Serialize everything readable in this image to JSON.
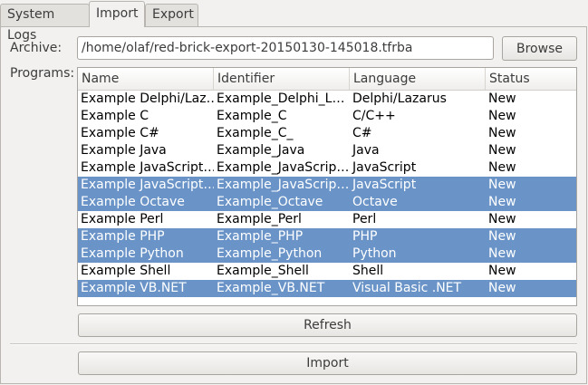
{
  "tabs": [
    {
      "label": "System Logs"
    },
    {
      "label": "Import"
    },
    {
      "label": "Export"
    }
  ],
  "archive": {
    "label": "Archive:",
    "value": "/home/olaf/red-brick-export-20150130-145018.tfrba",
    "browse_label": "Browse"
  },
  "programs": {
    "label": "Programs:",
    "columns": [
      "Name",
      "Identifier",
      "Language",
      "Status"
    ],
    "rows": [
      {
        "name": "Example Delphi/Laz…",
        "id": "Example_Delphi_L…",
        "lang": "Delphi/Lazarus",
        "status": "New",
        "selected": false
      },
      {
        "name": "Example C",
        "id": "Example_C",
        "lang": "C/C++",
        "status": "New",
        "selected": false
      },
      {
        "name": "Example C#",
        "id": "Example_C_",
        "lang": "C#",
        "status": "New",
        "selected": false
      },
      {
        "name": "Example Java",
        "id": "Example_Java",
        "lang": "Java",
        "status": "New",
        "selected": false
      },
      {
        "name": "Example JavaScript…",
        "id": "Example_JavaScrip…",
        "lang": "JavaScript",
        "status": "New",
        "selected": false
      },
      {
        "name": "Example JavaScript…",
        "id": "Example_JavaScrip…",
        "lang": "JavaScript",
        "status": "New",
        "selected": true
      },
      {
        "name": "Example Octave",
        "id": "Example_Octave",
        "lang": "Octave",
        "status": "New",
        "selected": true
      },
      {
        "name": "Example Perl",
        "id": "Example_Perl",
        "lang": "Perl",
        "status": "New",
        "selected": false
      },
      {
        "name": "Example PHP",
        "id": "Example_PHP",
        "lang": "PHP",
        "status": "New",
        "selected": true
      },
      {
        "name": "Example Python",
        "id": "Example_Python",
        "lang": "Python",
        "status": "New",
        "selected": true
      },
      {
        "name": "Example Shell",
        "id": "Example_Shell",
        "lang": "Shell",
        "status": "New",
        "selected": false
      },
      {
        "name": "Example VB.NET",
        "id": "Example_VB.NET",
        "lang": "Visual Basic .NET",
        "status": "New",
        "selected": true
      }
    ]
  },
  "actions": {
    "refresh_label": "Refresh",
    "import_label": "Import"
  },
  "colors": {
    "selection": "#6a94c8",
    "window_bg": "#f2f1f0"
  }
}
